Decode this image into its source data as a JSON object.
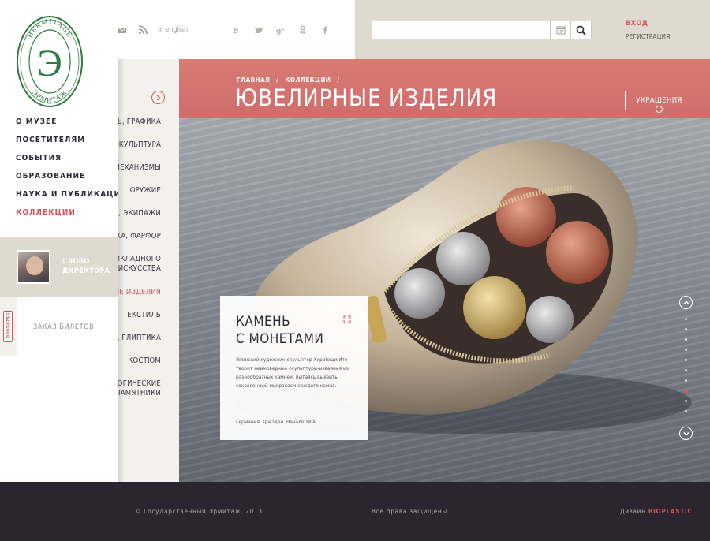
{
  "header": {
    "icons": [
      "mail-icon",
      "rss-icon"
    ],
    "lang_link": "in english",
    "social": [
      "vk-icon",
      "twitter-icon",
      "google-plus-icon",
      "odnoklassniki-icon",
      "facebook-icon"
    ],
    "search": {
      "value": "",
      "placeholder": ""
    },
    "login": "ВХОД",
    "register": "РЕГИСТРАЦИЯ"
  },
  "logo": {
    "text_top": "HERMITAGE",
    "text_bottom": "ЭРМИТАЖ",
    "letter": "Э"
  },
  "nav": {
    "items": [
      {
        "label": "О МУЗЕЕ"
      },
      {
        "label": "ПОСЕТИТЕЛЯМ"
      },
      {
        "label": "СОБЫТИЯ"
      },
      {
        "label": "ОБРАЗОВАНИЕ"
      },
      {
        "label": "НАУКА И ПУБЛИКАЦИИ"
      },
      {
        "label": "КОЛЛЕКЦИИ",
        "active": true
      }
    ]
  },
  "director": {
    "label_1": "СЛОВО",
    "label_2": "ДИРЕКТОРА"
  },
  "tickets": {
    "label": "ЗАКАЗ БИЛЕТОВ",
    "tab_code": "00974755"
  },
  "subnav": {
    "items": [
      {
        "label": "ИСЬ, ГРАФИКА"
      },
      {
        "label": "СКУЛЬПТУРА"
      },
      {
        "label": "МЕХАНИЗМЫ"
      },
      {
        "label": "ОРУЖИЕ"
      },
      {
        "label": "ЛЬ, ЭКИПАЖИ"
      },
      {
        "label": "ИКА, ФАРФОР"
      },
      {
        "label": "РИКЛАДНОГО",
        "line2": "ИСКУССТВА"
      },
      {
        "label": "ЫЕ ИЗДЕЛИЯ",
        "active": true
      },
      {
        "label": "ТЕКСТИЛЬ"
      },
      {
        "label": "КА, ГЛИПТИКА"
      },
      {
        "label": "КОСТЮМ"
      },
      {
        "label": "ЛОГИЧЕСКИЕ",
        "line2": "ПАМЯТНИКИ"
      }
    ]
  },
  "hero": {
    "breadcrumb": [
      "ГЛАВНАЯ",
      "/",
      "КОЛЛЕКЦИИ",
      "/"
    ],
    "title": "ЮВЕЛИРНЫЕ ИЗДЕЛИЯ",
    "category_button": "УКРАШЕНИЯ",
    "card": {
      "title_1": "КАМЕНЬ",
      "title_2": "С МОНЕТАМИ",
      "description": "Японский художник-скульптор Хироtoши Ито творит неимоверные скульптуры-изваяния из разнообразных камней, пытаясь выявить сокровенный микрокосм каждого камня.",
      "source": "Германия. Дрезден. Начало 18 в."
    },
    "slides": {
      "count": 10,
      "active": 7
    }
  },
  "footer": {
    "copyright": "© Государственный Эрмитаж, 2013.",
    "rights": "Все права защищены.",
    "design_label": "Дизайн",
    "design_by": "BIOPLASTIC"
  },
  "colors": {
    "accent": "#d7575b",
    "beige": "#dedad0",
    "dark": "#2a252e",
    "hero_red": "#cf6d6b"
  }
}
